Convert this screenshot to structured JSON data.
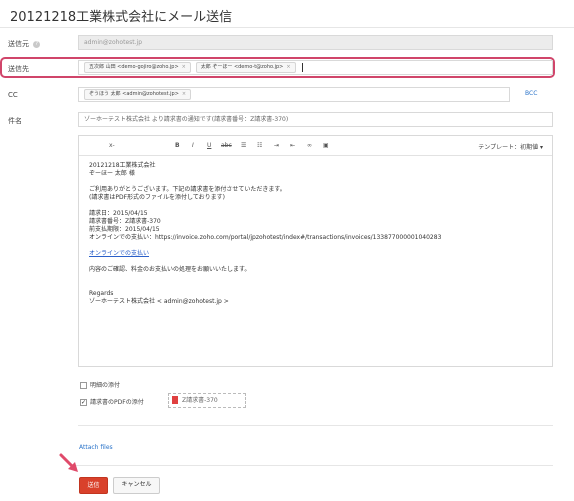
{
  "page": {
    "title": "20121218工業株式会社にメール送信"
  },
  "form": {
    "sender": {
      "label": "送信元",
      "value": "admin@zohotest.jp"
    },
    "to": {
      "label": "送信先",
      "chips": [
        "五次郎 山田 <demo-gojiro@zoho.jp>",
        "太郎 ぞーほー <demo-t@zoho.jp>"
      ]
    },
    "cc": {
      "label": "CC",
      "chips": [
        "ぞうほう 太郎 <admin@zohotest.jp>"
      ],
      "bcc_link": "BCC"
    },
    "subject": {
      "label": "件名",
      "value": "ゾーホーテスト株式会社 より請求書の通知です(請求書番号：Z請求書-370)"
    }
  },
  "editor": {
    "toolbar": {
      "fontsize": "x-",
      "bold": "B",
      "italic": "I",
      "underline": "U",
      "strike": "abc",
      "template_label": "テンプレート：初期値 ▾"
    },
    "body": {
      "line1": "20121218工業株式会社",
      "line2": "ぞーほー 太郎 様",
      "line3": "ご利用ありがとうございます。下記の請求書を添付させていただきます。",
      "line4": "(請求書はPDF形式のファイルを添付しております)",
      "line5": "請求日：2015/04/15",
      "line6": "請求書番号：Z請求書-370",
      "line7": "前支払期限：2015/04/15",
      "line8": "オンラインでの支払い：https://invoice.zoho.com/portal/jpzohotest/index#/transactions/invoices/133877000001040283",
      "link": "オンラインでの支払い",
      "line9": "内容のご確認、料金のお支払いの処理をお願いいたします。",
      "line10": "Regards",
      "line11": "ゾーホーテスト株式会社 < admin@zohotest.jp >"
    }
  },
  "options": {
    "statement": {
      "label": "明細の添付",
      "checked": false
    },
    "invoice_pdf": {
      "label": "請求書のPDFの添付",
      "checked": true
    },
    "attachment_name": "Z請求書-370"
  },
  "links": {
    "attach_files": "Attach files"
  },
  "buttons": {
    "send": "送信",
    "cancel": "キャンセル"
  },
  "colors": {
    "accent": "#d9412b",
    "highlight": "#d0456a",
    "link": "#2a73c9"
  }
}
